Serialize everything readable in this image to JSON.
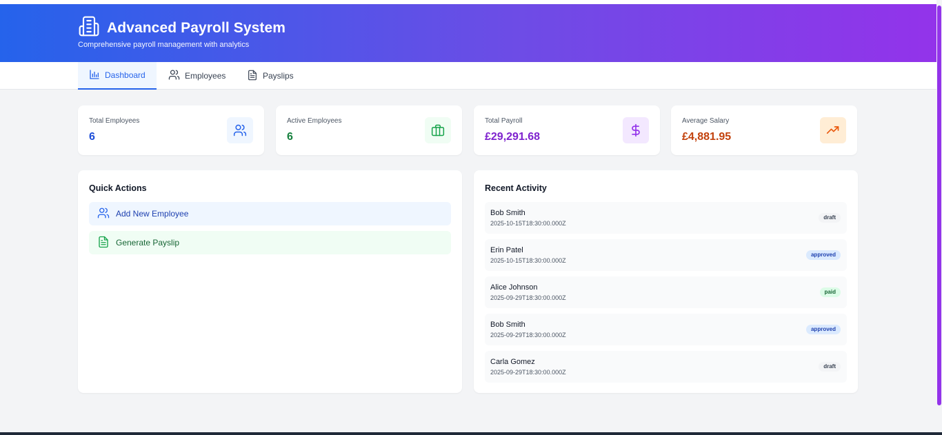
{
  "app": {
    "title": "Advanced Payroll System",
    "subtitle": "Comprehensive payroll management with analytics",
    "logo_icon": "building-icon"
  },
  "tabs": [
    {
      "label": "Dashboard",
      "icon": "bar-chart-icon",
      "active": true
    },
    {
      "label": "Employees",
      "icon": "users-icon",
      "active": false
    },
    {
      "label": "Payslips",
      "icon": "document-icon",
      "active": false
    }
  ],
  "stats": [
    {
      "label": "Total Employees",
      "value": "6",
      "color": "#1d4ed8",
      "icon": "users-icon",
      "icon_bg": "#eff6ff",
      "icon_color": "#2563eb"
    },
    {
      "label": "Active Employees",
      "value": "6",
      "color": "#15803d",
      "icon": "briefcase-icon",
      "icon_bg": "#f0fdf4",
      "icon_color": "#16a34a"
    },
    {
      "label": "Total Payroll",
      "value": "£29,291.68",
      "color": "#7e22ce",
      "icon": "dollar-icon",
      "icon_bg": "#f3e8ff",
      "icon_color": "#9333ea"
    },
    {
      "label": "Average Salary",
      "value": "£4,881.95",
      "color": "#c2410c",
      "icon": "trending-up-icon",
      "icon_bg": "#ffedd5",
      "icon_color": "#ea580c"
    }
  ],
  "quick_actions": {
    "title": "Quick Actions",
    "items": [
      {
        "label": "Add New Employee",
        "icon": "users-icon"
      },
      {
        "label": "Generate Payslip",
        "icon": "document-icon"
      }
    ]
  },
  "recent_activity": {
    "title": "Recent Activity",
    "items": [
      {
        "name": "Bob Smith",
        "date": "2025-10-15T18:30:00.000Z",
        "status": "draft"
      },
      {
        "name": "Erin Patel",
        "date": "2025-10-15T18:30:00.000Z",
        "status": "approved"
      },
      {
        "name": "Alice Johnson",
        "date": "2025-09-29T18:30:00.000Z",
        "status": "paid"
      },
      {
        "name": "Bob Smith",
        "date": "2025-09-29T18:30:00.000Z",
        "status": "approved"
      },
      {
        "name": "Carla Gomez",
        "date": "2025-09-29T18:30:00.000Z",
        "status": "draft"
      }
    ]
  }
}
